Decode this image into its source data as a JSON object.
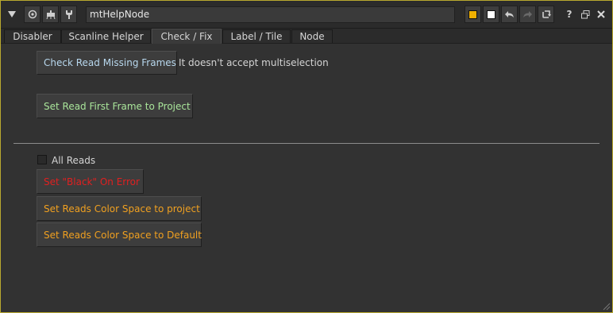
{
  "node_name": "mtHelpNode",
  "tabs": [
    {
      "label": "Disabler"
    },
    {
      "label": "Scanline Helper"
    },
    {
      "label": "Check / Fix"
    },
    {
      "label": "Label / Tile"
    },
    {
      "label": "Node"
    }
  ],
  "active_tab": "Check / Fix",
  "check_missing": {
    "button_label": "Check Read Missing Frames",
    "note": "It doesn't accept multiselection"
  },
  "set_first_frame": {
    "button_label": "Set Read First Frame to Project"
  },
  "all_reads": {
    "label": "All Reads",
    "checked": false
  },
  "actions": {
    "set_black_on_error": "Set \"Black\" On Error",
    "colorspace_project": "Set Reads Color Space to project",
    "colorspace_default": "Set Reads Color Space to Default"
  },
  "colors": {
    "panel_border": "#b9a92f",
    "node_color_swatch": "#f0b000",
    "gl_color_swatch": "#ffffff",
    "blue_text": "#b8d8ee",
    "green_text": "#a9e59a",
    "red_text": "#e02020",
    "orange_text": "#f0a020"
  },
  "icons": [
    "collapse-triangle-icon",
    "center-node-icon",
    "centipede-icon",
    "wrench-icon",
    "undo-icon",
    "redo-icon",
    "revert-icon",
    "help-icon",
    "float-window-icon",
    "close-icon",
    "resize-grip-icon"
  ]
}
